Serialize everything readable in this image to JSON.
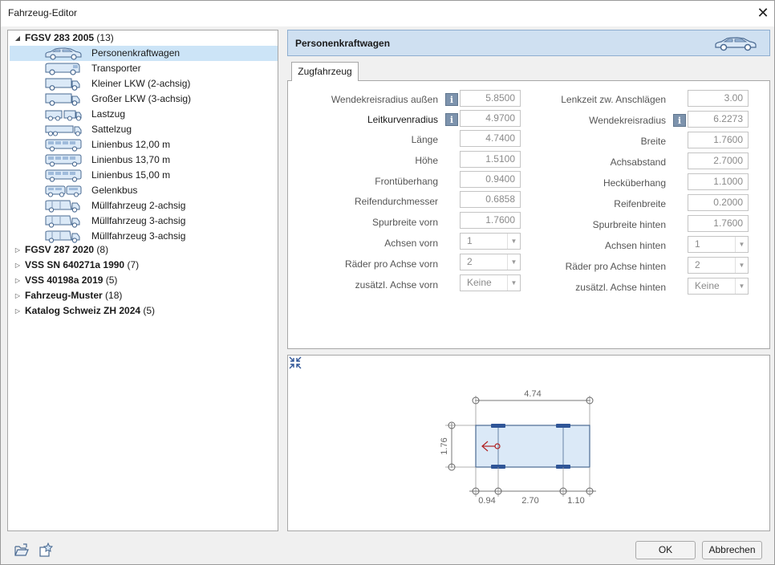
{
  "window": {
    "title": "Fahrzeug-Editor"
  },
  "tree": {
    "roots": [
      {
        "name": "FGSV 283 2005",
        "count": "(13)",
        "expanded": true
      },
      {
        "name": "FGSV 287 2020",
        "count": "(8)"
      },
      {
        "name": "VSS SN 640271a 1990",
        "count": "(7)"
      },
      {
        "name": "VSS 40198a 2019",
        "count": "(5)"
      },
      {
        "name": "Fahrzeug-Muster",
        "count": "(18)"
      },
      {
        "name": "Katalog Schweiz ZH 2024",
        "count": "(5)"
      }
    ],
    "vehicles": [
      {
        "label": "Personenkraftwagen",
        "icon": "car-icon",
        "selected": true
      },
      {
        "label": "Transporter",
        "icon": "van-icon"
      },
      {
        "label": "Kleiner LKW (2-achsig)",
        "icon": "truck-icon"
      },
      {
        "label": "Großer LKW (3-achsig)",
        "icon": "truck-icon"
      },
      {
        "label": "Lastzug",
        "icon": "truck-trailer-icon"
      },
      {
        "label": "Sattelzug",
        "icon": "semi-truck-icon"
      },
      {
        "label": "Linienbus 12,00 m",
        "icon": "bus-icon"
      },
      {
        "label": "Linienbus 13,70 m",
        "icon": "bus-icon"
      },
      {
        "label": "Linienbus 15,00 m",
        "icon": "bus-icon"
      },
      {
        "label": "Gelenkbus",
        "icon": "articulated-bus-icon"
      },
      {
        "label": "Müllfahrzeug 2-achsig",
        "icon": "garbage-truck-icon"
      },
      {
        "label": "Müllfahrzeug 3-achsig",
        "icon": "garbage-truck-icon"
      },
      {
        "label": "Müllfahrzeug 3-achsig",
        "icon": "garbage-truck-icon"
      }
    ]
  },
  "header": {
    "title": "Personenkraftwagen",
    "icon": "car-icon"
  },
  "tabs": [
    {
      "label": "Zugfahrzeug",
      "active": true
    }
  ],
  "fields_left": [
    {
      "label": "Wendekreisradius außen",
      "value": "5.8500",
      "info": true
    },
    {
      "label": "Leitkurvenradius",
      "value": "4.9700",
      "info": true
    },
    {
      "label": "Länge",
      "value": "4.7400"
    },
    {
      "label": "Höhe",
      "value": "1.5100"
    },
    {
      "label": "Frontüberhang",
      "value": "0.9400"
    },
    {
      "label": "Reifendurchmesser",
      "value": "0.6858"
    },
    {
      "label": "Spurbreite vorn",
      "value": "1.7600"
    }
  ],
  "combos_left": [
    {
      "label": "Achsen vorn",
      "value": "1"
    },
    {
      "label": "Räder pro Achse vorn",
      "value": "2"
    },
    {
      "label": "zusätzl. Achse vorn",
      "value": "Keine"
    }
  ],
  "fields_right": [
    {
      "label": "Lenkzeit zw. Anschlägen",
      "value": "3.00"
    },
    {
      "label": "Wendekreisradius",
      "value": "6.2273",
      "info": true
    },
    {
      "label": "Breite",
      "value": "1.7600"
    },
    {
      "label": "Achsabstand",
      "value": "2.7000"
    },
    {
      "label": "Hecküberhang",
      "value": "1.1000"
    },
    {
      "label": "Reifenbreite",
      "value": "0.2000"
    },
    {
      "label": "Spurbreite hinten",
      "value": "1.7600"
    }
  ],
  "combos_right": [
    {
      "label": "Achsen hinten",
      "value": "1"
    },
    {
      "label": "Räder pro Achse hinten",
      "value": "2"
    },
    {
      "label": "zusätzl. Achse hinten",
      "value": "Keine"
    }
  ],
  "preview": {
    "length_label": "4.74",
    "width_label": "1.76",
    "front_overhang_label": "0.94",
    "wheelbase_label": "2.70",
    "rear_overhang_label": "1.10"
  },
  "footer": {
    "ok_label": "OK",
    "cancel_label": "Abbrechen",
    "icons": [
      "open-folder-icon",
      "favorite-icon"
    ]
  },
  "colors": {
    "selection": "#cce4f7",
    "header_bg": "#cfe0f1",
    "vehicle_fill": "#dbe9f7",
    "vehicle_stroke": "#4a6a92",
    "tire": "#2f5597",
    "direction_arrow": "#b02020"
  }
}
